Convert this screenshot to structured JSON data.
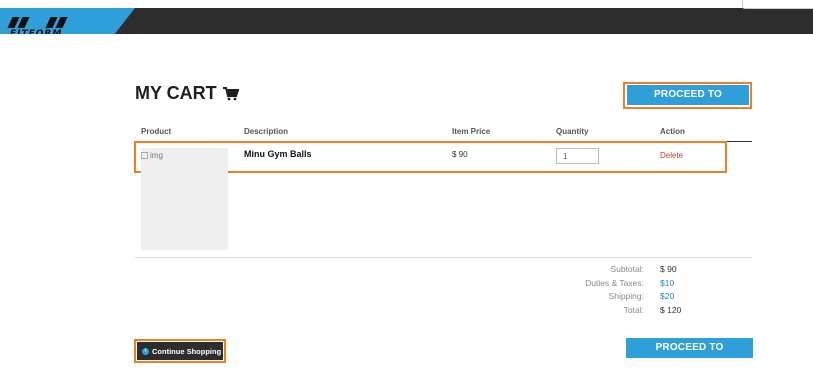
{
  "header": {
    "logo_text": "FITFORM",
    "colors": {
      "brand_blue": "#2f9fd9",
      "bar_dark": "#2d2d2d",
      "highlight_orange": "#f07f22"
    }
  },
  "cart": {
    "title": "MY CART",
    "title_icon": "shopping-cart-icon",
    "checkout_label": "PROCEED TO CHECKOUT",
    "continue_label": "Continue Shopping",
    "continue_icon": "chevron-left-circle-icon"
  },
  "table": {
    "columns": [
      "Product",
      "Description",
      "Item Price",
      "Quantity",
      "Action"
    ],
    "rows": [
      {
        "image_alt": "img",
        "description": "Minu Gym Balls",
        "price": "$ 90",
        "quantity": "1",
        "action": "Delete"
      }
    ]
  },
  "summary": {
    "subtotal_label": "Subtotal:",
    "subtotal_value": "$ 90",
    "duties_label": "Duties & Taxes:",
    "duties_value": "$10",
    "shipping_label": "Shipping:",
    "shipping_value": "$20",
    "total_label": "Total:",
    "total_value": "$ 120"
  }
}
